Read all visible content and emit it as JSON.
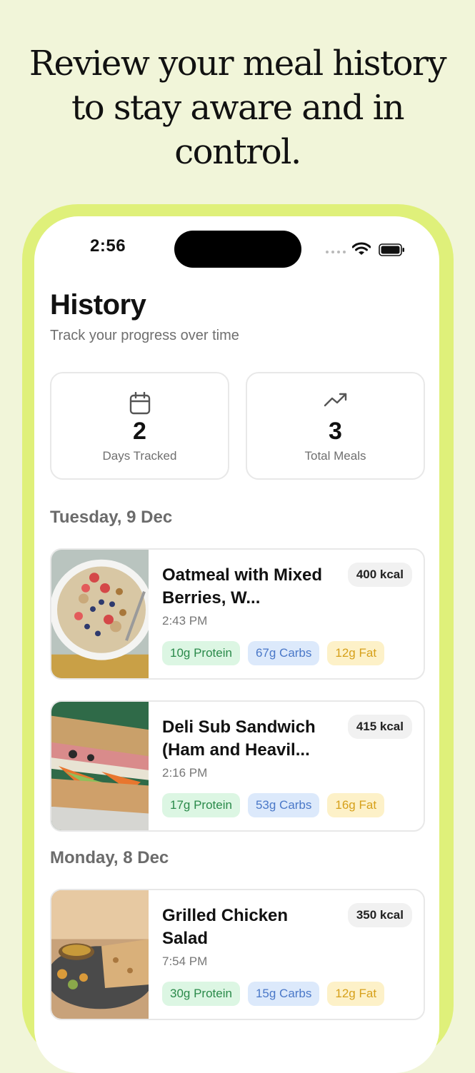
{
  "headline": {
    "line1": "Review your meal history",
    "line2": "to stay aware and in",
    "line3": "control."
  },
  "status_bar": {
    "time": "2:56"
  },
  "page": {
    "title": "History",
    "subtitle": "Track your progress over time"
  },
  "stats": [
    {
      "icon": "calendar-icon",
      "value": "2",
      "label": "Days Tracked"
    },
    {
      "icon": "trending-up-icon",
      "value": "3",
      "label": "Total Meals"
    }
  ],
  "days": [
    {
      "header": "Tuesday, 9 Dec",
      "meals": [
        {
          "name": "Oatmeal with Mixed Berries, W...",
          "time": "2:43 PM",
          "kcal": "400 kcal",
          "protein": "10g Protein",
          "carbs": "67g Carbs",
          "fat": "12g Fat"
        },
        {
          "name": "Deli Sub Sandwich (Ham and Heavil...",
          "time": "2:16 PM",
          "kcal": "415 kcal",
          "protein": "17g Protein",
          "carbs": "53g Carbs",
          "fat": "16g Fat"
        }
      ]
    },
    {
      "header": "Monday, 8 Dec",
      "meals": [
        {
          "name": "Grilled Chicken Salad",
          "time": "7:54 PM",
          "kcal": "350 kcal",
          "protein": "30g Protein",
          "carbs": "15g Carbs",
          "fat": "12g Fat"
        }
      ]
    }
  ],
  "colors": {
    "background": "#f1f5d9",
    "phone_frame": "#dff07a",
    "protein": "#2a8a4a",
    "carbs": "#4a78c8",
    "fat": "#d6a01a"
  }
}
